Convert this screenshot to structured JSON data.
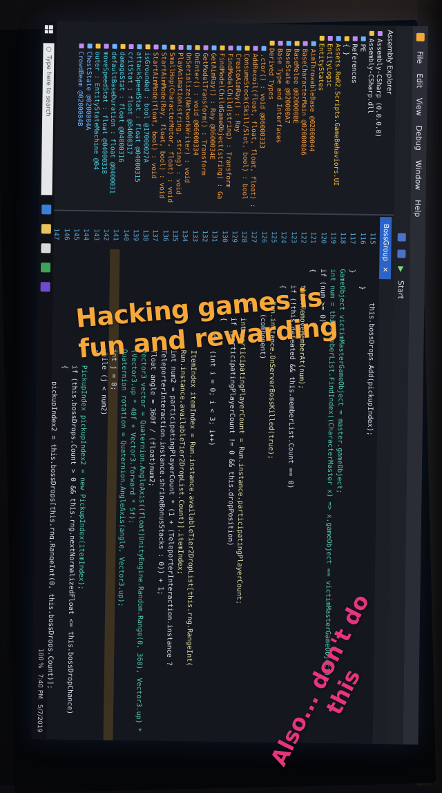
{
  "overlay": {
    "line1": "Hacking games is",
    "line2": "fun and rewarding",
    "line3": "Also... don't do",
    "line4": "this"
  },
  "menu": [
    "File",
    "Edit",
    "View",
    "Debug",
    "Window",
    "Help"
  ],
  "toolbar": {
    "start_label": "Start"
  },
  "explorer": {
    "title": "Assembly Explorer",
    "items": [
      "Assembly-CSharp (0.0.0.0)",
      "Assembly-CSharp.dll",
      "PE",
      "References",
      "{ }",
      "Assets.RoR2.Scripts.GameBehaviors.UI",
      "EntityLogic",
      "EntityStates",
      "AimThrowableBase @02000044",
      "BaseCharacterMain @020000A6",
      "BaseMelee @020000BE",
      "BaseState @020000A7",
      "Base Type and Interfaces",
      "Derived Types",
      ".ctor() : void @06000333",
      "AddRecoil(float, float, float, float) : vo",
      "ConsumeStock(Skill/Slot, bool) : bool",
      "CreateAimRay() : Ray",
      "FindModelChild(string) : Transform",
      "FindModelChildGameObject(string) : Ga",
      "GetAimRay() : Ray @0600034E",
      "GetModelTransform() : Transform",
      "OnEnter() : void @06000334",
      "OnSerialize(NetworkWriter) : void",
      "PlayAnimation(string, string) : void",
      "SmallHop(CharacterMotor, float) : void",
      "StartAimMode(Ray, float, bool) : void",
      "StartAimMode(float, bool) : void",
      "isGrounded : bool @17000027A",
      "attackSpeedStat : float @04000315",
      "critStat : float @04000317",
      "damageStat : float @04000316",
      "defaultBaseDuration : float @0400031",
      "moveSpeedStat : float @04000318",
      "outer : EntityStateMachine @04",
      "ChestState @0200004A",
      "CrowdBeam @0200004B"
    ]
  },
  "tab": {
    "label": "BossGroup",
    "close": "×"
  },
  "code": {
    "line_numbers": [
      "115",
      "116",
      "117",
      "118",
      "119",
      "120",
      "121",
      "122",
      "123",
      "124",
      "125",
      "126",
      "127",
      "128",
      "129",
      "130",
      "131",
      "132",
      "133",
      "134",
      "135",
      "136",
      "137",
      "138",
      "139",
      "140",
      "141",
      "142",
      "143",
      "144",
      "145",
      "146",
      "147",
      "148",
      "149",
      "150",
      "151",
      "152",
      "153",
      "154",
      "155"
    ],
    "lines": [
      "            this.bossDrops.Add(pickupIndex);",
      "        }",
      "    }",
      "    GameObject victimMasterGameObject = master.gameObject;",
      "    int num = this.memberList.FindIndex((CharacterMaster x) => x.gameObject == victimMasterGameObject);",
      "    if (num >= 0)",
      "    {",
      "        this.RemoveMemberAt(num);",
      "        if (!this.defeated && this.memberList.Count == 0)",
      "        {",
      "            Run.instance.OnServerBossKilled(true);",
      "            if (component)",
      "            {",
      "                int participatingPlayerCount = Run.instance.participatingPlayerCount;",
      "                if (participatingPlayerCount != 0 && this.dropPosition)",
      "                {",
      "                    for (int i = 0; i < 3; i++)",
      "                    {",
      "                        ItemIndex itemIndex = Run.instance.availableTier2DropList[this.rng.RangeInt(",
      "                        Run.instance.availableTier2DropList.Count)].itemIndex;",
      "                        int num2 = participatingPlayerCount * (1 + (TeleporterInteraction.instance ?",
      "                        TeleporterInteraction.instance.shrineBonusStacks : 0)) + 1;",
      "                        float angle = 360f / (float)num2;",
      "                        Vector3 vector = Quaternion.AngleAxis((float)UnityEngine.Random.Range(0, 360), Vector3.up) *",
      "                        (Vector3.up * 40f + Vector3.forward * 5f);",
      "                        Quaternion rotation = Quaternion.AngleAxis(angle, Vector3.up);",
      "                        int j = 0;",
      "                        while (j < num2)",
      "                        {",
      "                            PickupIndex pickupIndex2 = new PickupIndex(itemIndex);",
      "                            if (this.bossDrops.Count > 0 && this.rng.nextNormalizedFloat <= this.bossDropChance)",
      "                            {",
      "                                pickupIndex2 = this.bossDrops[this.rng.RangeInt(0, this.bossDrops.Count)];",
      "                            }",
      "                            PickupDropletController.CreatePickupDroplet(pickupIndex2, this.dropPosition.position, vector);",
      "                            j++;",
      "                            vector = rotation * vector;",
      "                        }",
      "                    }",
      "                }",
      "            }"
    ]
  },
  "taskbar": {
    "search_placeholder": "Type here to search",
    "time": "7:40 PM",
    "date": "5/7/2019",
    "zoom": "100 %"
  }
}
